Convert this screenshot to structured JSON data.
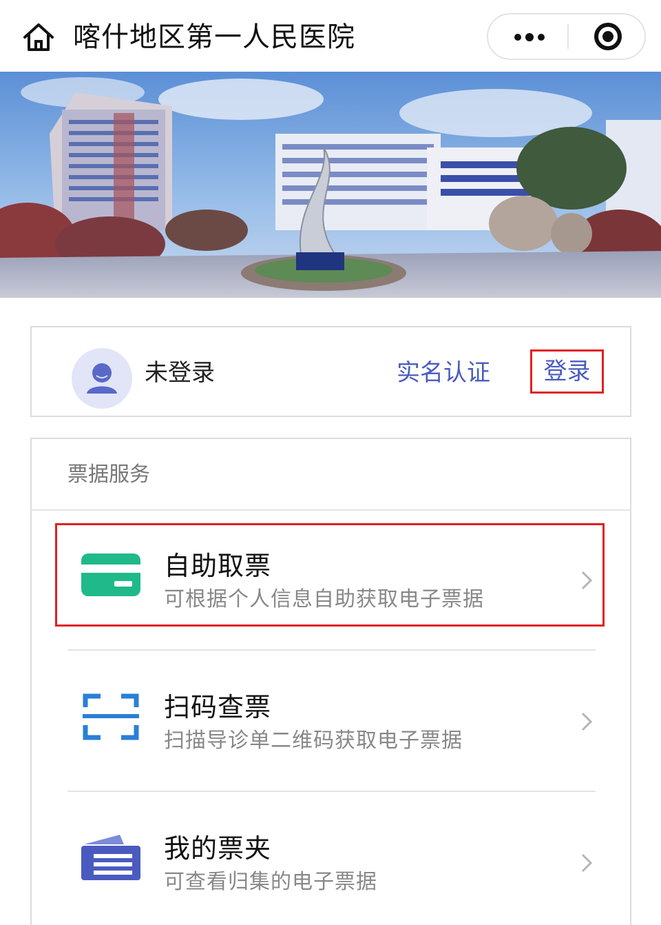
{
  "navbar": {
    "title": "喀什地区第一人民医院",
    "home_icon": "home-icon",
    "more_icon": "more-dots-icon",
    "close_icon": "target-close-icon"
  },
  "banner": {
    "description_icon": "hospital-banner-image"
  },
  "login_card": {
    "status": "未登录",
    "realname_label": "实名认证",
    "login_label": "登录",
    "avatar_icon": "user-avatar-icon"
  },
  "services": {
    "section_title": "票据服务",
    "items": [
      {
        "title": "自助取票",
        "desc": "可根据个人信息自助获取电子票据",
        "icon": "card-icon",
        "icon_color": "#20b98a"
      },
      {
        "title": "扫码查票",
        "desc": "扫描导诊单二维码获取电子票据",
        "icon": "scan-icon",
        "icon_color": "#2a7fd8"
      },
      {
        "title": "我的票夹",
        "desc": "可查看归集的电子票据",
        "icon": "ticket-folder-icon",
        "icon_color": "#4a5bbf"
      }
    ]
  },
  "colors": {
    "accent": "#4a5bbf",
    "highlight": "#e02020",
    "green": "#20b98a",
    "blue": "#2a7fd8"
  }
}
